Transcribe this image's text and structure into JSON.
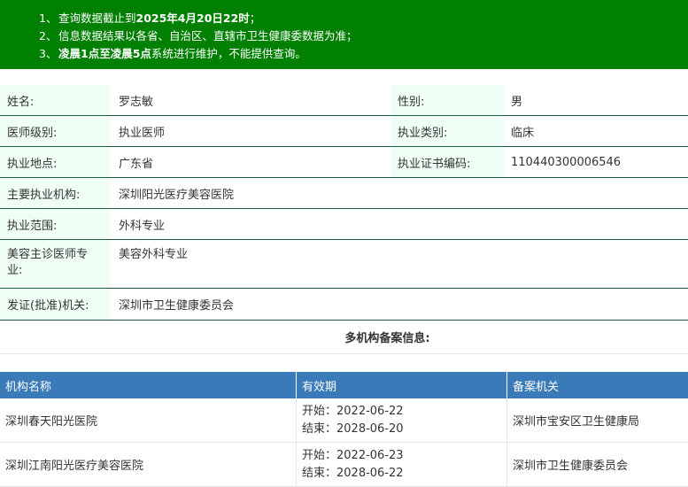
{
  "notice": {
    "items": [
      {
        "num": "1、",
        "pre": "查询数据截止到",
        "bold": "2025年4月20日22时",
        "post": "；"
      },
      {
        "num": "2、",
        "pre": "信息数据结果以各省、自治区、直辖市卫生健康委数据为准；",
        "bold": "",
        "post": ""
      },
      {
        "num": "3、",
        "pre": "",
        "bold": "凌晨1点至凌晨5点",
        "post": "系统进行维护，不能提供查询。"
      }
    ]
  },
  "doctor": {
    "name_label": "姓名:",
    "name": "罗志敏",
    "gender_label": "性别:",
    "gender": "男",
    "level_label": "医师级别:",
    "level": "执业医师",
    "category_label": "执业类别:",
    "category": "临床",
    "location_label": "执业地点:",
    "location": "广东省",
    "cert_label": "执业证书编码:",
    "cert": "110440300006546",
    "org_label": "主要执业机构:",
    "org": "深圳阳光医疗美容医院",
    "scope_label": "执业范围:",
    "scope": "外科专业",
    "cosmetic_label": "美容主诊医师专业:",
    "cosmetic": "美容外科专业",
    "issuer_label": "发证(批准)机关:",
    "issuer": "深圳市卫生健康委员会"
  },
  "multi": {
    "title": "多机构备案信息:",
    "headers": [
      "机构名称",
      "有效期",
      "备案机关"
    ],
    "rows": [
      {
        "org": "深圳春天阳光医院",
        "start": "开始：2022-06-22",
        "end": "结束：2028-06-20",
        "authority": "深圳市宝安区卫生健康局"
      },
      {
        "org": "深圳江南阳光医疗美容医院",
        "start": "开始：2022-06-23",
        "end": "结束：2028-06-22",
        "authority": "深圳市卫生健康委员会"
      }
    ]
  },
  "colors": {
    "notice_bg": "#008000",
    "label_bg": "#f0fff5",
    "table_header_bg": "#3a7ab8",
    "border": "#1f5f3f"
  }
}
